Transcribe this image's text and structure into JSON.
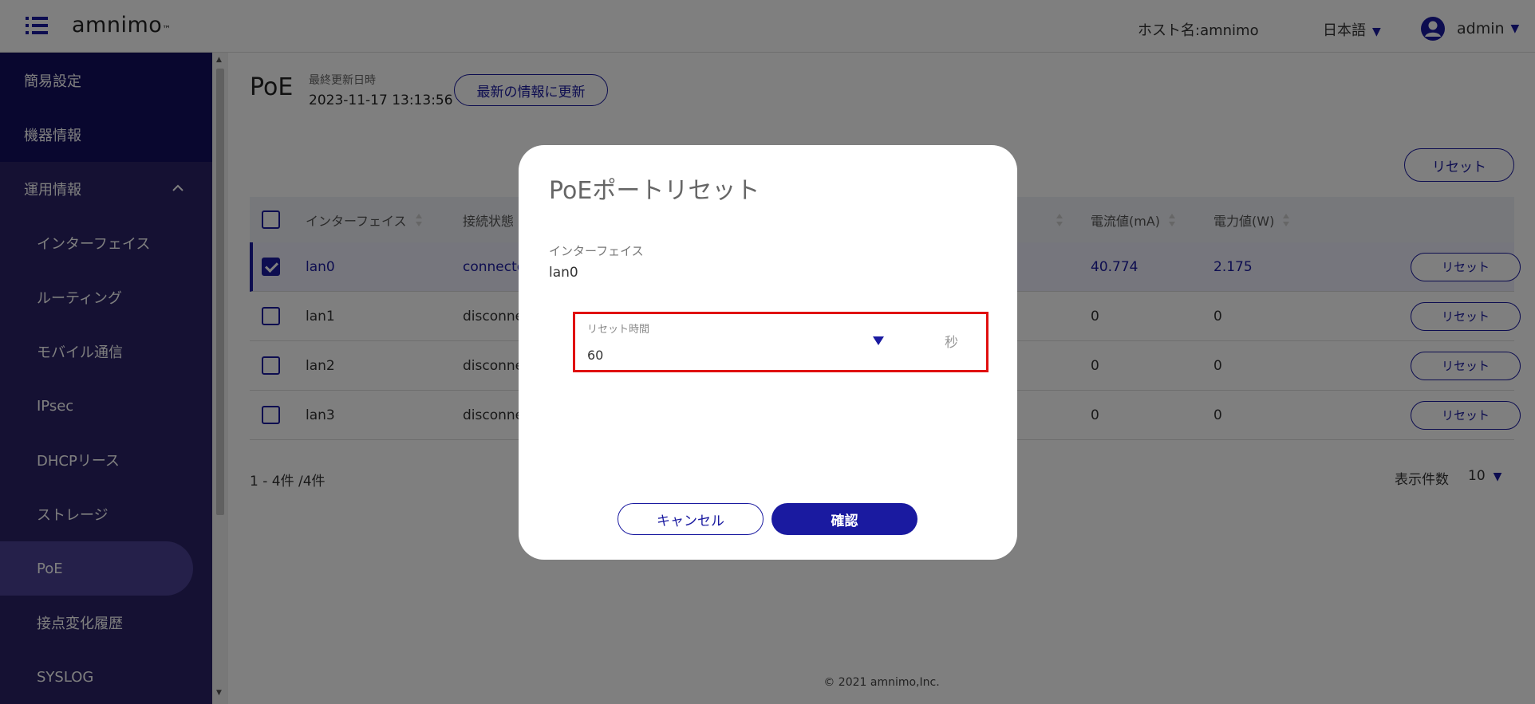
{
  "header": {
    "logo_text": "amnimo",
    "logo_tm": "™",
    "host": "ホスト名:amnimo",
    "language": "日本語",
    "user": "admin"
  },
  "sidebar": {
    "items": [
      {
        "label": "簡易設定"
      },
      {
        "label": "機器情報"
      },
      {
        "label": "運用情報"
      },
      {
        "label": "インターフェイス"
      },
      {
        "label": "ルーティング"
      },
      {
        "label": "モバイル通信"
      },
      {
        "label": "IPsec"
      },
      {
        "label": "DHCPリース"
      },
      {
        "label": "ストレージ"
      },
      {
        "label": "PoE"
      },
      {
        "label": "接点変化履歴"
      },
      {
        "label": "SYSLOG"
      }
    ]
  },
  "main": {
    "title": "PoE",
    "last_updated_label": "最終更新日時",
    "last_updated_value": "2023-11-17 13:13:56",
    "refresh_label": "最新の情報に更新",
    "reset_all_label": "リセット",
    "columns": [
      "インターフェイス",
      "接続状態",
      "電流値(mA)",
      "電力値(W)"
    ],
    "rows": [
      {
        "iface": "lan0",
        "status": "connecte",
        "current": "40.774",
        "power": "2.175",
        "reset": "リセット"
      },
      {
        "iface": "lan1",
        "status": "disconne",
        "current": "0",
        "power": "0",
        "reset": "リセット"
      },
      {
        "iface": "lan2",
        "status": "disconne",
        "current": "0",
        "power": "0",
        "reset": "リセット"
      },
      {
        "iface": "lan3",
        "status": "disconne",
        "current": "0",
        "power": "0",
        "reset": "リセット"
      }
    ],
    "count": "1 - 4件 /4件",
    "per_page_label": "表示件数",
    "per_page_value": "10",
    "footer": "© 2021 amnimo,Inc."
  },
  "dialog": {
    "title": "PoEポートリセット",
    "interface_label": "インターフェイス",
    "interface_value": "lan0",
    "reset_time_label": "リセット時間",
    "reset_time_value": "60",
    "reset_time_unit": "秒",
    "cancel_label": "キャンセル",
    "confirm_label": "確認"
  },
  "colors": {
    "accent": "#1a1aa0",
    "sidebar_bg": "#2a2366",
    "sidebar_active": "#4a4194",
    "highlight": "#e01010"
  }
}
